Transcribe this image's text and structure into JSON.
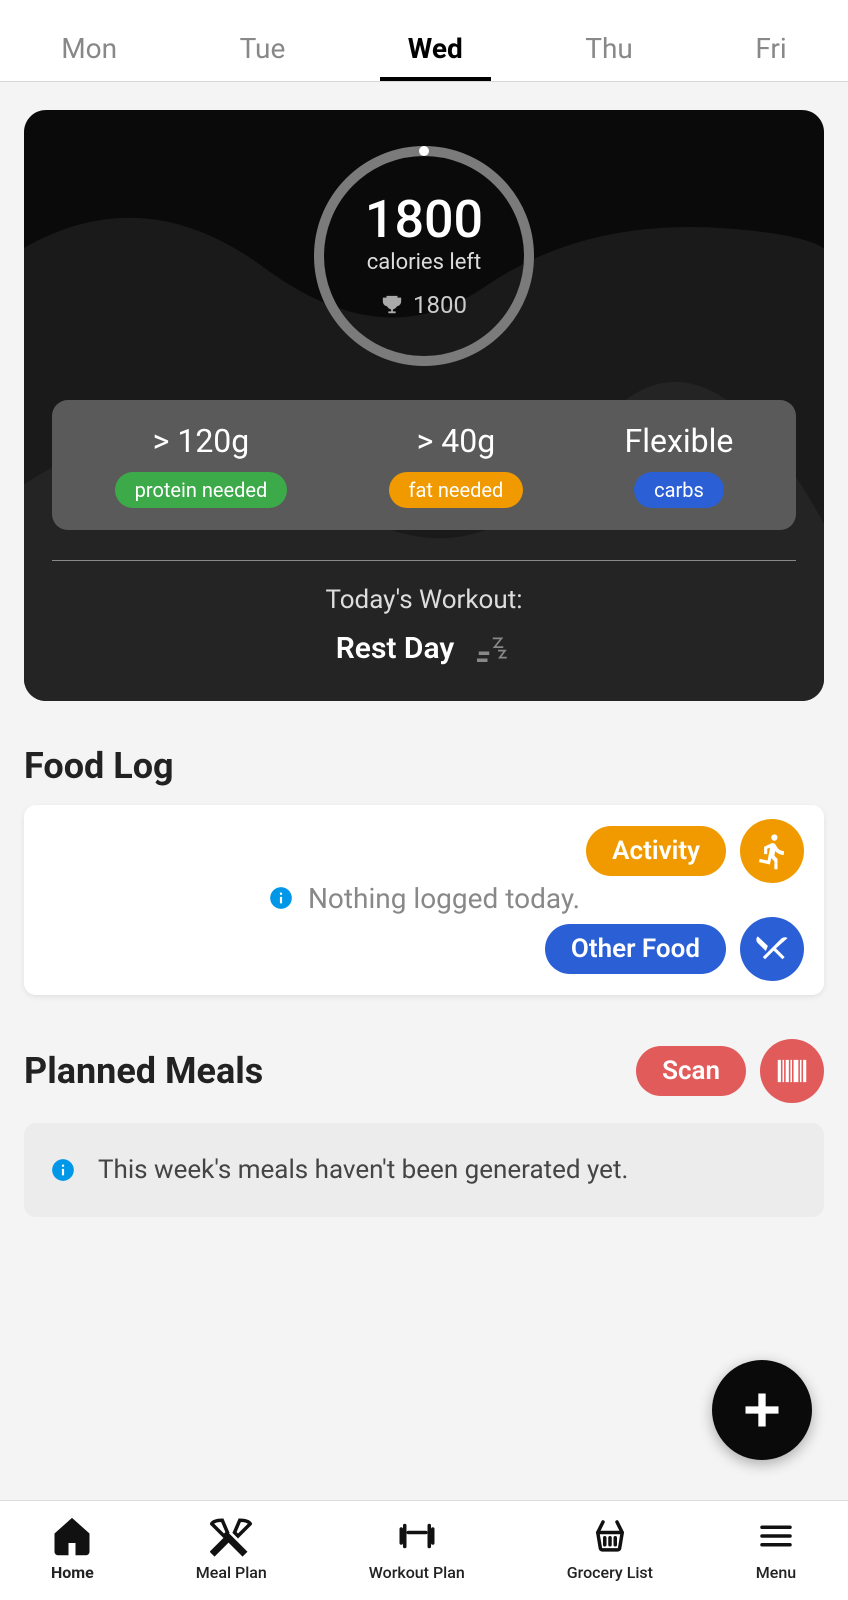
{
  "days": [
    "Mon",
    "Tue",
    "Wed",
    "Thu",
    "Fri"
  ],
  "activeDay": "Wed",
  "dashboard": {
    "calories_left": "1800",
    "calories_left_label": "calories left",
    "calories_goal": "1800",
    "macros": [
      {
        "value": "> 120g",
        "label": "protein needed",
        "color": "green"
      },
      {
        "value": "> 40g",
        "label": "fat needed",
        "color": "orange"
      },
      {
        "value": "Flexible",
        "label": "carbs",
        "color": "blue"
      }
    ],
    "workout_title": "Today's Workout:",
    "workout_name": "Rest Day"
  },
  "foodLog": {
    "heading": "Food Log",
    "empty_text": "Nothing logged today.",
    "activity_label": "Activity",
    "other_food_label": "Other Food"
  },
  "plannedMeals": {
    "heading": "Planned Meals",
    "scan_label": "Scan",
    "empty_text": "This week's meals haven't been generated yet."
  },
  "bottomNav": [
    {
      "id": "home",
      "label": "Home",
      "active": true
    },
    {
      "id": "meal-plan",
      "label": "Meal Plan",
      "active": false
    },
    {
      "id": "workout-plan",
      "label": "Workout Plan",
      "active": false
    },
    {
      "id": "grocery-list",
      "label": "Grocery List",
      "active": false
    },
    {
      "id": "menu",
      "label": "Menu",
      "active": false
    }
  ]
}
